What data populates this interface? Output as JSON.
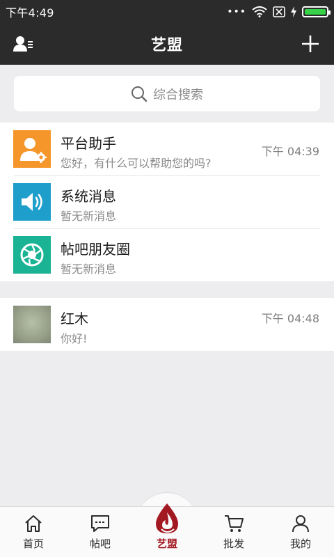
{
  "status_bar": {
    "time": "下午4:49",
    "dots": "•••"
  },
  "header": {
    "title": "艺盟"
  },
  "search": {
    "placeholder": "综合搜索"
  },
  "chats_system": [
    {
      "title": "平台助手",
      "subtitle": "您好，有什么可以帮助您的吗?",
      "time": "下午 04:39",
      "icon": "assistant-icon",
      "color": "#f5962a"
    },
    {
      "title": "系统消息",
      "subtitle": "暂无新消息",
      "time": "",
      "icon": "speaker-icon",
      "color": "#1e9ecb"
    },
    {
      "title": "帖吧朋友圈",
      "subtitle": "暂无新消息",
      "time": "",
      "icon": "aperture-icon",
      "color": "#1ab394"
    }
  ],
  "chats_users": [
    {
      "title": "红木",
      "subtitle": "你好!",
      "time": "下午 04:48"
    }
  ],
  "tabbar": [
    {
      "label": "首页",
      "icon": "home-icon"
    },
    {
      "label": "帖吧",
      "icon": "chat-bubble-icon"
    },
    {
      "label": "艺盟",
      "icon": "drop-logo-icon",
      "active": true
    },
    {
      "label": "批发",
      "icon": "cart-icon"
    },
    {
      "label": "我的",
      "icon": "user-icon"
    }
  ],
  "colors": {
    "accent": "#a31922",
    "header": "#2b2b2b",
    "background": "#ededf0"
  }
}
